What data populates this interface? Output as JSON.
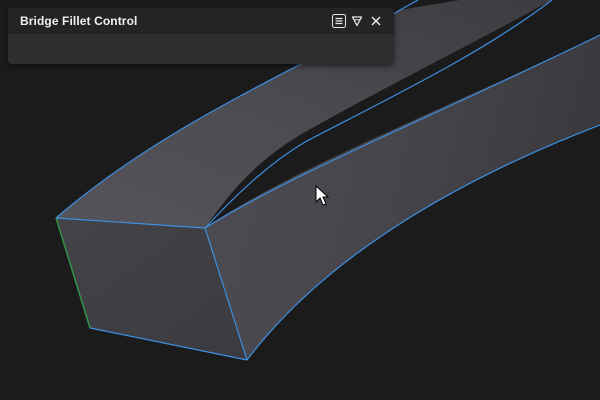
{
  "panel": {
    "title": "Bridge Fillet Control",
    "icons": {
      "menu": "hamburger-menu-icon",
      "collapse": "collapse-triangle-icon",
      "close": "close-icon"
    }
  },
  "viewport": {
    "background": "#1b1b1c",
    "surface_color": "#48474c",
    "edge_color": "#3d8fe0",
    "selected_edge_color": "#2e9a48",
    "cursor": "arrow-cursor-icon"
  }
}
